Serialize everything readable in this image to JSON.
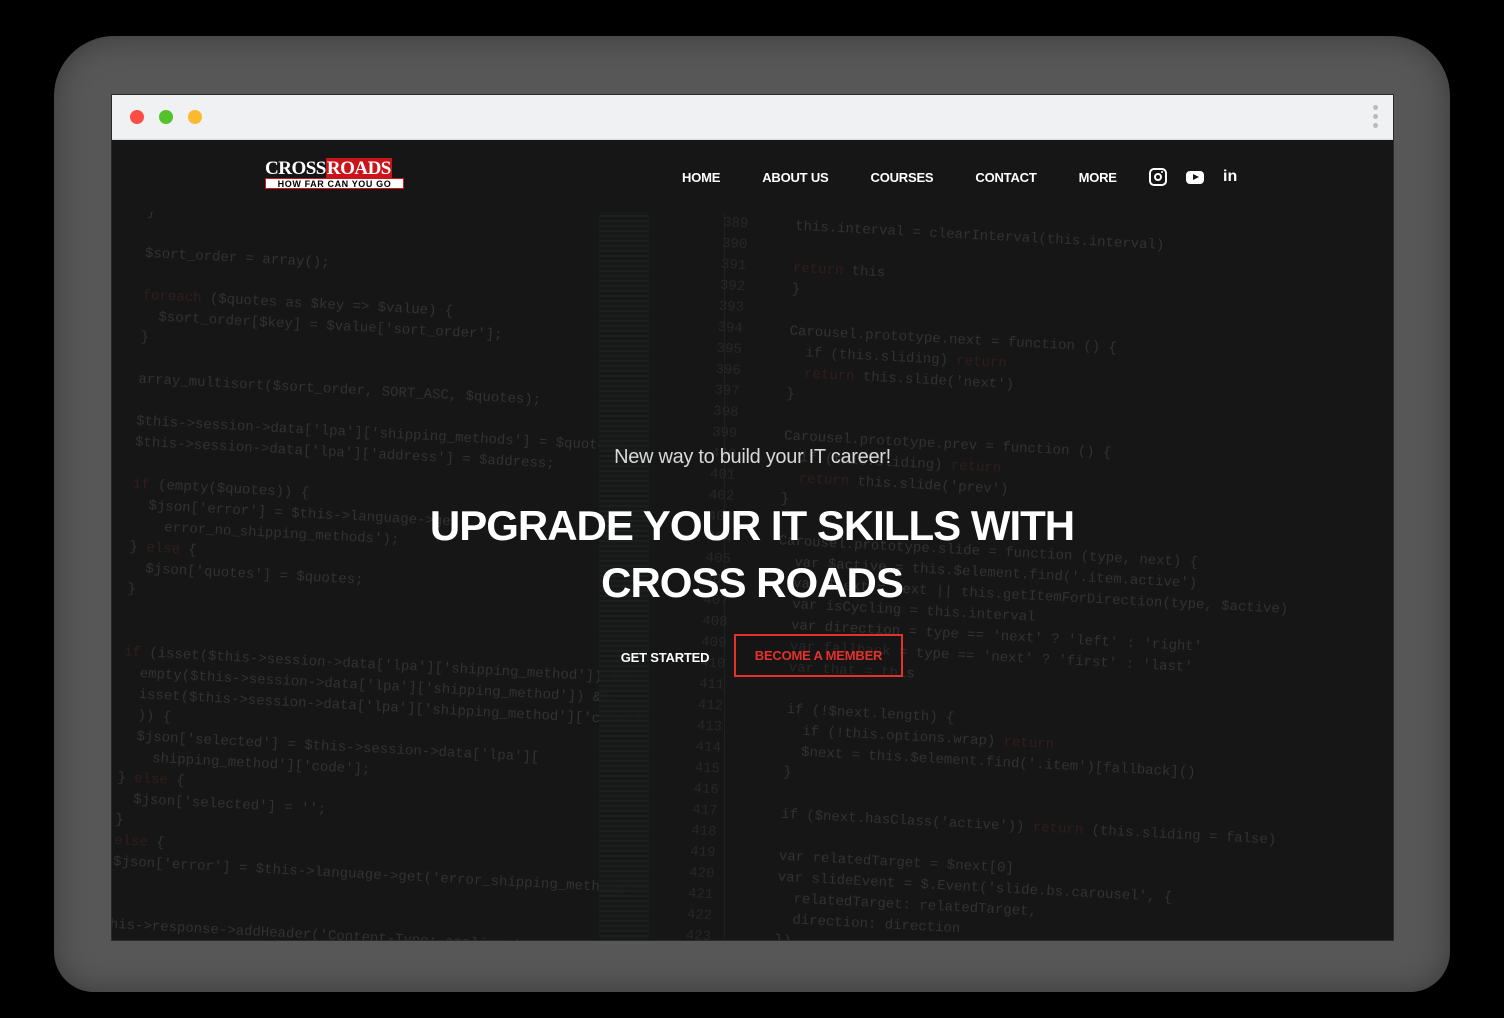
{
  "brand": {
    "logo_cross": "CROSS",
    "logo_roads": "ROADS",
    "logo_tagline": "HOW FAR CAN YOU GO"
  },
  "nav": {
    "items": [
      "HOME",
      "ABOUT US",
      "COURSES",
      "CONTACT",
      "MORE"
    ]
  },
  "social": {
    "icons": [
      "instagram-icon",
      "youtube-icon",
      "linkedin-icon"
    ],
    "linkedin_glyph": "in"
  },
  "hero": {
    "subtitle": "New way to build your IT career!",
    "title": "UPGRADE YOUR IT SKILLS WITH CROSS ROADS",
    "primary_button": "GET STARTED",
    "secondary_button": "BECOME A MEMBER"
  },
  "colors": {
    "accent": "#e5312b",
    "brand_red": "#d0161c",
    "background": "#1a1a1b",
    "titlebar": "#f0f1f2"
  }
}
